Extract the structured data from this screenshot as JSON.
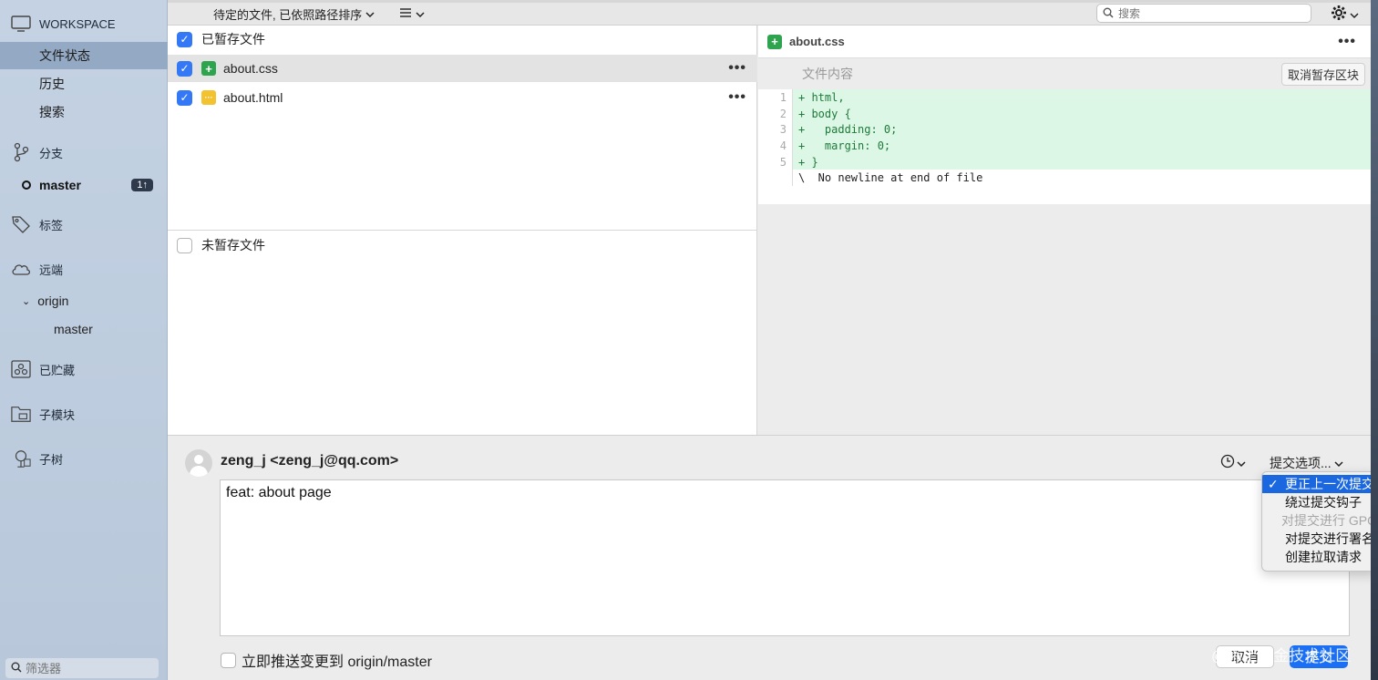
{
  "sidebar": {
    "workspace": "WORKSPACE",
    "workspace_items": [
      "文件状态",
      "历史",
      "搜索"
    ],
    "branches_label": "分支",
    "current_branch": "master",
    "branch_badge": "1↑",
    "tags_label": "标签",
    "remotes_label": "远端",
    "remote_name": "origin",
    "remote_branch": "master",
    "stashes_label": "已贮藏",
    "submodules_label": "子模块",
    "subtrees_label": "子树",
    "filter_placeholder": "筛选器"
  },
  "toolbar": {
    "sort_label": "待定的文件, 已依照路径排序",
    "search_placeholder": "搜索"
  },
  "files": {
    "staged_header": "已暂存文件",
    "staged": [
      {
        "name": "about.css",
        "status": "added"
      },
      {
        "name": "about.html",
        "status": "modified"
      }
    ],
    "unstaged_header": "未暂存文件"
  },
  "diff": {
    "filename": "about.css",
    "hunk_title": "文件内容",
    "unstage_button": "取消暂存区块",
    "lines": [
      {
        "num": "1",
        "text": "+ html,"
      },
      {
        "num": "2",
        "text": "+ body {"
      },
      {
        "num": "3",
        "text": "+   padding: 0;"
      },
      {
        "num": "4",
        "text": "+   margin: 0;"
      },
      {
        "num": "5",
        "text": "+ }"
      },
      {
        "num": "",
        "text": "\\  No newline at end of file"
      }
    ]
  },
  "commit": {
    "author": "zeng_j <zeng_j@qq.com>",
    "options_label": "提交选项...",
    "message": "feat: about page",
    "push_label": "立即推送变更到 origin/master",
    "cancel": "取消",
    "submit": "提交",
    "watermark": "@稀土掘金技术社区"
  },
  "menu": {
    "items": [
      {
        "label": "更正上一次提交",
        "checked": true,
        "state": "active"
      },
      {
        "label": "绕过提交钩子",
        "checked": false,
        "state": "normal"
      },
      {
        "label": "对提交进行 GPG",
        "checked": false,
        "state": "disabled"
      },
      {
        "label": "对提交进行署名",
        "checked": false,
        "state": "normal"
      },
      {
        "label": "创建拉取请求",
        "checked": false,
        "state": "normal"
      }
    ]
  },
  "colors": {
    "accent": "#3478f6",
    "sidebar_active": "#94a9c3",
    "added_line": "#dcf7e5",
    "commit_button": "#1b6ff5"
  }
}
